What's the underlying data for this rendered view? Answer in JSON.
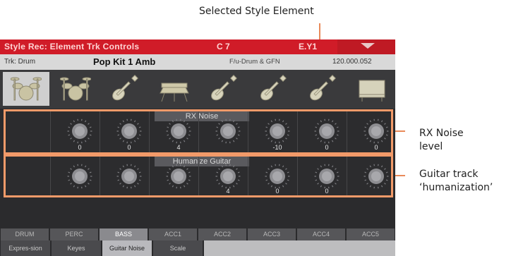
{
  "callouts": {
    "selected_element": "Selected Style Element",
    "rx_noise_line1": "RX Noise",
    "rx_noise_line2": "level",
    "humanize_line1": "Guitar track",
    "humanize_line2": "‘humanization’"
  },
  "header": {
    "title": "Style Rec: Element Trk Controls",
    "chord": "C 7",
    "variation": "E.Y1"
  },
  "info": {
    "track": "Trk: Drum",
    "kit": "Pop Kit 1 Amb",
    "favorite": "F/u-Drum & GFN",
    "tempo": "120.000.052"
  },
  "tracks": [
    {
      "icon": "drum-kit-icon",
      "selected": true
    },
    {
      "icon": "drum-kit-icon",
      "selected": false
    },
    {
      "icon": "guitar-icon",
      "selected": false
    },
    {
      "icon": "synth-keyboard-icon",
      "selected": false
    },
    {
      "icon": "guitar-icon",
      "selected": false
    },
    {
      "icon": "guitar-icon",
      "selected": false
    },
    {
      "icon": "guitar-icon",
      "selected": false
    },
    {
      "icon": "piano-icon",
      "selected": false
    }
  ],
  "rx_noise": {
    "title": "RX Noise",
    "values": [
      "",
      "0",
      "0",
      "4",
      "",
      "-10",
      "0",
      "0"
    ]
  },
  "humanize": {
    "title": "Humanize Guitar",
    "values": [
      "",
      "",
      "",
      "",
      "4",
      "0",
      "0",
      ""
    ]
  },
  "bottom_tabs": [
    "DRUM",
    "PERC",
    "BASS",
    "ACC1",
    "ACC2",
    "ACC3",
    "ACC4",
    "ACC5"
  ],
  "bottom_tabs_selected": 2,
  "page_tabs": [
    "Expres-sion",
    "Keyes",
    "Guitar Noise",
    "Scale"
  ],
  "page_tabs_selected": 2,
  "colors": {
    "title_bar": "#d01c28",
    "highlight_box": "#f29a69",
    "panel_bg": "#2c2c2e"
  }
}
